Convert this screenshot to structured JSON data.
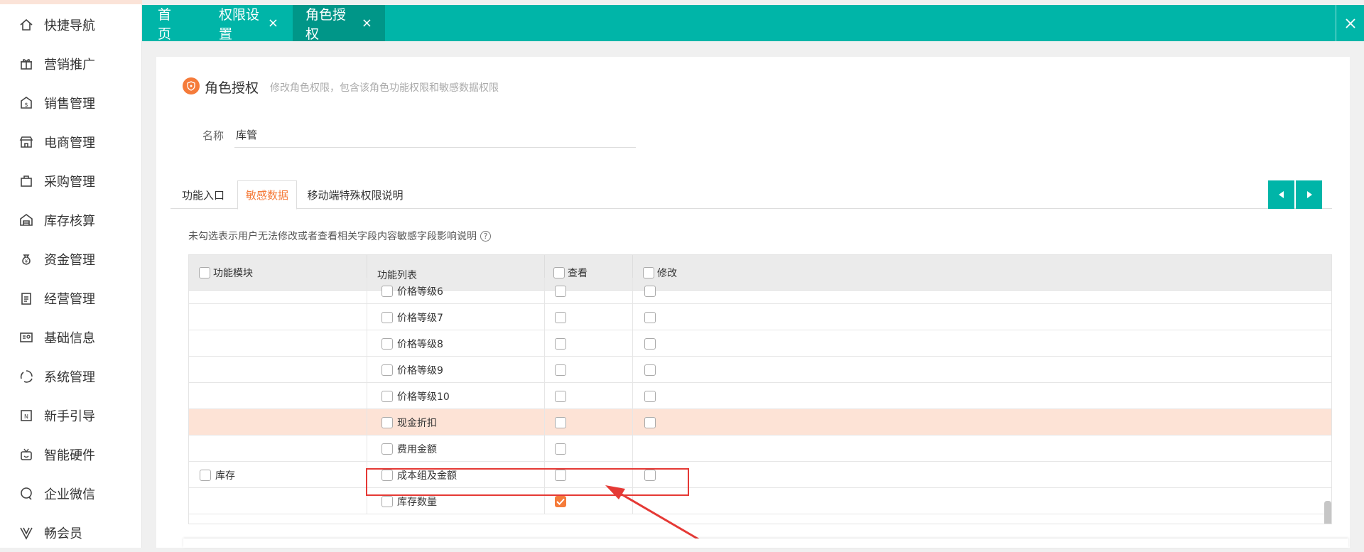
{
  "sidebar": {
    "items": [
      {
        "label": "快捷导航",
        "icon": "home-icon"
      },
      {
        "label": "营销推广",
        "icon": "gift-icon"
      },
      {
        "label": "销售管理",
        "icon": "dollar-tag-icon"
      },
      {
        "label": "电商管理",
        "icon": "store-icon"
      },
      {
        "label": "采购管理",
        "icon": "bag-icon"
      },
      {
        "label": "库存核算",
        "icon": "warehouse-icon"
      },
      {
        "label": "资金管理",
        "icon": "money-bag-icon"
      },
      {
        "label": "经营管理",
        "icon": "clipboard-icon"
      },
      {
        "label": "基础信息",
        "icon": "id-card-icon"
      },
      {
        "label": "系统管理",
        "icon": "system-cycle-icon"
      },
      {
        "label": "新手引导",
        "icon": "new-badge-icon"
      },
      {
        "label": "智能硬件",
        "icon": "smart-device-icon"
      },
      {
        "label": "企业微信",
        "icon": "chat-icon"
      },
      {
        "label": "畅会员",
        "icon": "v-member-icon"
      }
    ]
  },
  "topbar": {
    "tabs": [
      {
        "label": "首页",
        "closable": false,
        "active": false
      },
      {
        "label": "权限设置",
        "closable": true,
        "active": false
      },
      {
        "label": "角色授权",
        "closable": true,
        "active": true
      }
    ],
    "close_symbol": "✕",
    "tab_close_symbol": "×"
  },
  "page": {
    "title": "角色授权",
    "subtitle": "修改角色权限，包含该角色功能权限和敏感数据权限",
    "name_label": "名称",
    "name_value": "库管"
  },
  "subtabs": [
    {
      "label": "功能入口",
      "active": false
    },
    {
      "label": "敏感数据",
      "active": true
    },
    {
      "label": "移动端特殊权限说明",
      "active": false
    }
  ],
  "hint": {
    "text": "未勾选表示用户无法修改或者查看相关字段内容敏感字段影响说明",
    "help_symbol": "?"
  },
  "table": {
    "headers": {
      "module": "功能模块",
      "list": "功能列表",
      "view": "查看",
      "edit": "修改"
    },
    "rows": [
      {
        "module": "",
        "item": "价格等级6",
        "view": false,
        "edit": false,
        "highlight": false,
        "edit_visible": true
      },
      {
        "module": "",
        "item": "价格等级7",
        "view": false,
        "edit": false,
        "highlight": false,
        "edit_visible": true
      },
      {
        "module": "",
        "item": "价格等级8",
        "view": false,
        "edit": false,
        "highlight": false,
        "edit_visible": true
      },
      {
        "module": "",
        "item": "价格等级9",
        "view": false,
        "edit": false,
        "highlight": false,
        "edit_visible": true
      },
      {
        "module": "",
        "item": "价格等级10",
        "view": false,
        "edit": false,
        "highlight": false,
        "edit_visible": true
      },
      {
        "module": "",
        "item": "现金折扣",
        "view": false,
        "edit": false,
        "highlight": true,
        "edit_visible": true
      },
      {
        "module": "",
        "item": "费用金额",
        "view": false,
        "edit": false,
        "highlight": false,
        "edit_visible": false
      },
      {
        "module": "库存",
        "item": "成本组及金额",
        "view": false,
        "edit": false,
        "highlight": false,
        "edit_visible": true
      },
      {
        "module": "",
        "item": "库存数量",
        "view": true,
        "edit": false,
        "highlight": false,
        "edit_visible": false
      }
    ]
  },
  "colors": {
    "teal": "#00b5a8",
    "teal_dark": "#009688",
    "orange": "#f57b3a",
    "highlight_row": "#fde3d6",
    "annotation_red": "#e53935"
  }
}
